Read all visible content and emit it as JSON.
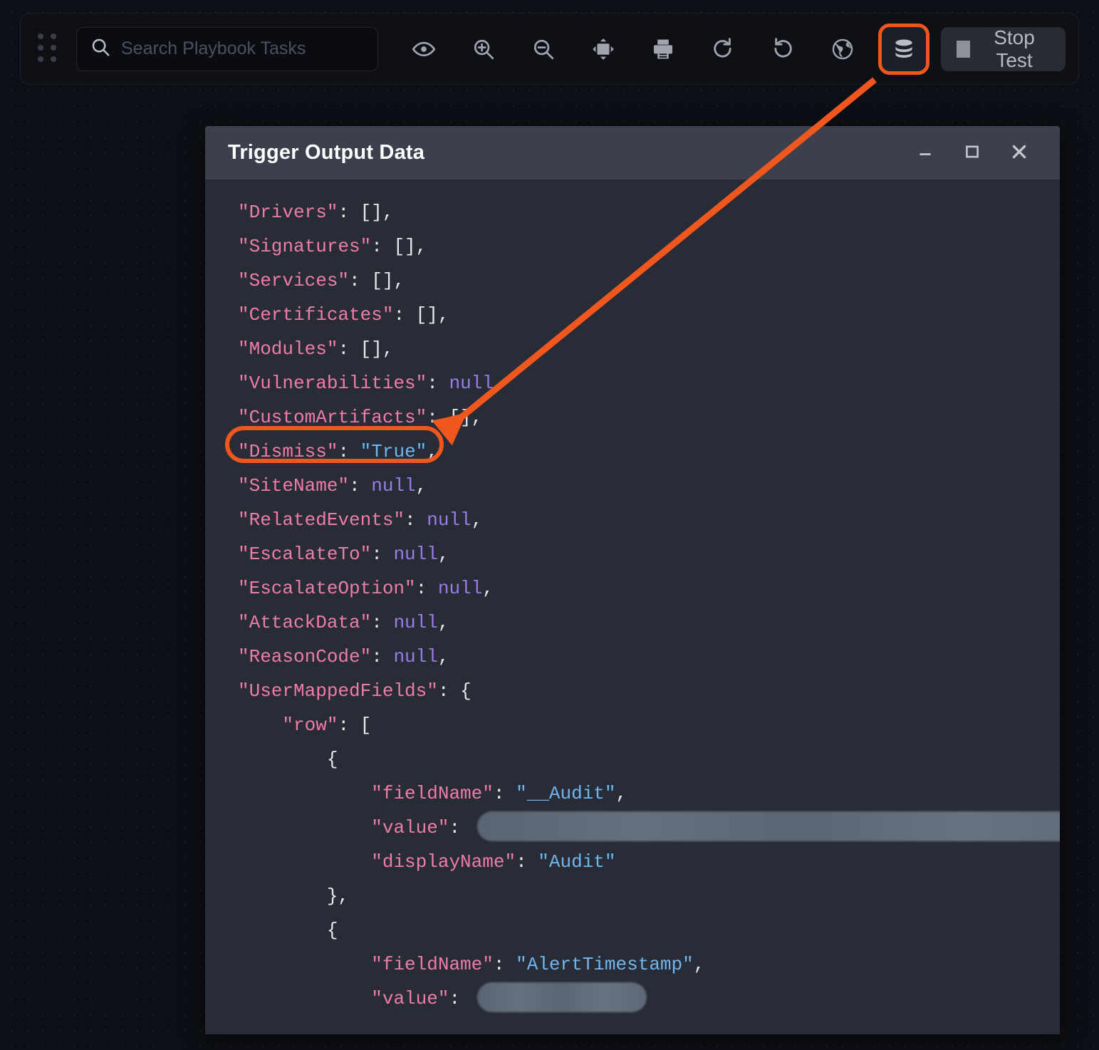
{
  "theme": {
    "canvas_bg": "#0d0f16",
    "toolbar_bg": "#0e1016",
    "dialog_bg": "#282c36",
    "titlebar_bg": "#3b404c",
    "annotation_orange": "#f0571f",
    "json_key_color": "#f07ca8",
    "json_string_color": "#6fb7f0",
    "json_null_color": "#9a7ce8"
  },
  "toolbar": {
    "drag_handle_name": "drag-handle",
    "search": {
      "placeholder": "Search Playbook Tasks",
      "value": ""
    },
    "buttons": [
      {
        "name": "preview-icon",
        "label": "Preview"
      },
      {
        "name": "zoom-in-icon",
        "label": "Zoom In"
      },
      {
        "name": "zoom-out-icon",
        "label": "Zoom Out"
      },
      {
        "name": "fit-to-screen-icon",
        "label": "Fit To Screen"
      },
      {
        "name": "print-icon",
        "label": "Print"
      },
      {
        "name": "redo-icon",
        "label": "Redo"
      },
      {
        "name": "undo-icon",
        "label": "Undo"
      },
      {
        "name": "globe-icon",
        "label": "Global"
      },
      {
        "name": "database-icon",
        "label": "Trigger Output Data",
        "highlighted": true
      }
    ],
    "stop_test": {
      "label": "Stop Test",
      "icon": "stop-square-icon"
    }
  },
  "dialog": {
    "title": "Trigger Output Data",
    "controls": {
      "minimize": "minimize-icon",
      "maximize": "maximize-icon",
      "close": "close-icon"
    },
    "json_lines": [
      {
        "indent": 0,
        "parts": [
          {
            "t": "k",
            "v": "\"Drivers\""
          },
          {
            "t": "p",
            "v": ": [],"
          }
        ]
      },
      {
        "indent": 0,
        "parts": [
          {
            "t": "k",
            "v": "\"Signatures\""
          },
          {
            "t": "p",
            "v": ": [],"
          }
        ]
      },
      {
        "indent": 0,
        "parts": [
          {
            "t": "k",
            "v": "\"Services\""
          },
          {
            "t": "p",
            "v": ": [],"
          }
        ]
      },
      {
        "indent": 0,
        "parts": [
          {
            "t": "k",
            "v": "\"Certificates\""
          },
          {
            "t": "p",
            "v": ": [],"
          }
        ]
      },
      {
        "indent": 0,
        "parts": [
          {
            "t": "k",
            "v": "\"Modules\""
          },
          {
            "t": "p",
            "v": ": [],"
          }
        ]
      },
      {
        "indent": 0,
        "parts": [
          {
            "t": "k",
            "v": "\"Vulnerabilities\""
          },
          {
            "t": "p",
            "v": ": "
          },
          {
            "t": "nul",
            "v": "null"
          },
          {
            "t": "p",
            "v": ","
          }
        ]
      },
      {
        "indent": 0,
        "parts": [
          {
            "t": "k",
            "v": "\"CustomArtifacts\""
          },
          {
            "t": "p",
            "v": ": [],"
          }
        ]
      },
      {
        "indent": 0,
        "highlighted": true,
        "parts": [
          {
            "t": "k",
            "v": "\"Dismiss\""
          },
          {
            "t": "p",
            "v": ": "
          },
          {
            "t": "s",
            "v": "\"True\""
          },
          {
            "t": "p",
            "v": ","
          }
        ]
      },
      {
        "indent": 0,
        "parts": [
          {
            "t": "k",
            "v": "\"SiteName\""
          },
          {
            "t": "p",
            "v": ": "
          },
          {
            "t": "nul",
            "v": "null"
          },
          {
            "t": "p",
            "v": ","
          }
        ]
      },
      {
        "indent": 0,
        "parts": [
          {
            "t": "k",
            "v": "\"RelatedEvents\""
          },
          {
            "t": "p",
            "v": ": "
          },
          {
            "t": "nul",
            "v": "null"
          },
          {
            "t": "p",
            "v": ","
          }
        ]
      },
      {
        "indent": 0,
        "parts": [
          {
            "t": "k",
            "v": "\"EscalateTo\""
          },
          {
            "t": "p",
            "v": ": "
          },
          {
            "t": "nul",
            "v": "null"
          },
          {
            "t": "p",
            "v": ","
          }
        ]
      },
      {
        "indent": 0,
        "parts": [
          {
            "t": "k",
            "v": "\"EscalateOption\""
          },
          {
            "t": "p",
            "v": ": "
          },
          {
            "t": "nul",
            "v": "null"
          },
          {
            "t": "p",
            "v": ","
          }
        ]
      },
      {
        "indent": 0,
        "parts": [
          {
            "t": "k",
            "v": "\"AttackData\""
          },
          {
            "t": "p",
            "v": ": "
          },
          {
            "t": "nul",
            "v": "null"
          },
          {
            "t": "p",
            "v": ","
          }
        ]
      },
      {
        "indent": 0,
        "parts": [
          {
            "t": "k",
            "v": "\"ReasonCode\""
          },
          {
            "t": "p",
            "v": ": "
          },
          {
            "t": "nul",
            "v": "null"
          },
          {
            "t": "p",
            "v": ","
          }
        ]
      },
      {
        "indent": 0,
        "parts": [
          {
            "t": "k",
            "v": "\"UserMappedFields\""
          },
          {
            "t": "p",
            "v": ": {"
          }
        ]
      },
      {
        "indent": 1,
        "parts": [
          {
            "t": "k",
            "v": "\"row\""
          },
          {
            "t": "p",
            "v": ": ["
          }
        ]
      },
      {
        "indent": 2,
        "parts": [
          {
            "t": "p",
            "v": "{"
          }
        ]
      },
      {
        "indent": 3,
        "parts": [
          {
            "t": "k",
            "v": "\"fieldName\""
          },
          {
            "t": "p",
            "v": ": "
          },
          {
            "t": "s",
            "v": "\"__Audit\""
          },
          {
            "t": "p",
            "v": ","
          }
        ]
      },
      {
        "indent": 3,
        "parts": [
          {
            "t": "k",
            "v": "\"value\""
          },
          {
            "t": "p",
            "v": ": "
          },
          {
            "t": "redact",
            "v": "wide"
          }
        ]
      },
      {
        "indent": 3,
        "parts": [
          {
            "t": "k",
            "v": "\"displayName\""
          },
          {
            "t": "p",
            "v": ": "
          },
          {
            "t": "s",
            "v": "\"Audit\""
          }
        ]
      },
      {
        "indent": 2,
        "parts": [
          {
            "t": "p",
            "v": "},"
          }
        ]
      },
      {
        "indent": 2,
        "parts": [
          {
            "t": "p",
            "v": "{"
          }
        ]
      },
      {
        "indent": 3,
        "parts": [
          {
            "t": "k",
            "v": "\"fieldName\""
          },
          {
            "t": "p",
            "v": ": "
          },
          {
            "t": "s",
            "v": "\"AlertTimestamp\""
          },
          {
            "t": "p",
            "v": ","
          }
        ]
      },
      {
        "indent": 3,
        "parts": [
          {
            "t": "k",
            "v": "\"value\""
          },
          {
            "t": "p",
            "v": ": "
          },
          {
            "t": "redact",
            "v": "narrow"
          }
        ]
      }
    ]
  },
  "annotations": {
    "arrow": {
      "from": "database-icon",
      "to": "dismiss-json-line",
      "color": "#f0571f"
    },
    "highlight_boxes": [
      {
        "name": "database-icon-highlight",
        "target": "database-icon"
      },
      {
        "name": "dismiss-line-highlight",
        "target": "dismiss-json-line"
      }
    ]
  }
}
